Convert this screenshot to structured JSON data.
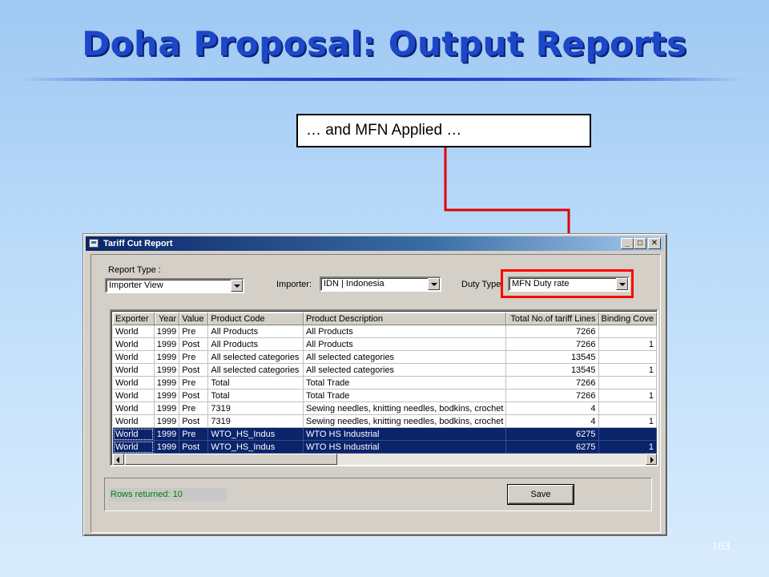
{
  "slide": {
    "title": "Doha Proposal: Output Reports",
    "callout": "… and MFN Applied …",
    "page_number": "163"
  },
  "window": {
    "title": "Tariff Cut Report",
    "min_glyph": "_",
    "max_glyph": "□",
    "close_glyph": "✕"
  },
  "controls": {
    "report_type_label": "Report Type :",
    "report_type_value": "Importer View",
    "importer_label": "Importer:",
    "importer_value": "IDN | Indonesia",
    "duty_type_label": "Duty Type:",
    "duty_type_value": "MFN Duty rate"
  },
  "grid": {
    "columns": [
      "Exporter",
      "Year",
      "Value",
      "Product Code",
      "Product Description",
      "Total No.of tariff Lines",
      "Binding Cove"
    ],
    "rows": [
      [
        "World",
        "1999",
        "Pre",
        " All Products",
        " All Products",
        "7266",
        ""
      ],
      [
        "World",
        "1999",
        "Post",
        " All Products",
        " All Products",
        "7266",
        "1"
      ],
      [
        "World",
        "1999",
        "Pre",
        " All selected categories",
        " All selected categories",
        "13545",
        ""
      ],
      [
        "World",
        "1999",
        "Post",
        " All selected categories",
        " All selected categories",
        "13545",
        "1"
      ],
      [
        "World",
        "1999",
        "Pre",
        " Total",
        "Total Trade",
        "7266",
        ""
      ],
      [
        "World",
        "1999",
        "Post",
        " Total",
        "Total Trade",
        "7266",
        "1"
      ],
      [
        "World",
        "1999",
        "Pre",
        "7319",
        "Sewing needles, knitting needles, bodkins, crochet",
        "4",
        ""
      ],
      [
        "World",
        "1999",
        "Post",
        "7319",
        "Sewing needles, knitting needles, bodkins, crochet",
        "4",
        "1"
      ],
      [
        "World",
        "1999",
        "Pre",
        "WTO_HS_Indus",
        "WTO HS Industrial",
        "6275",
        ""
      ],
      [
        "World",
        "1999",
        "Post",
        "WTO_HS_Indus",
        "WTO HS Industrial",
        "6275",
        "1"
      ]
    ],
    "selected_rows": [
      8,
      9
    ]
  },
  "footer": {
    "status": "Rows returned: 10",
    "save_label": "Save"
  },
  "colors": {
    "title_blue": "#1c47c9",
    "highlight_red": "#ff0000",
    "selection": "#0a246a",
    "status_green": "#008000"
  }
}
